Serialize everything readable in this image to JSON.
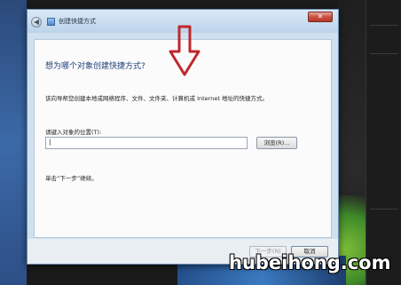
{
  "window": {
    "title": "创建快捷方式",
    "close_label": "✕",
    "back_label": "◀"
  },
  "content": {
    "heading": "想为哪个对象创建快捷方式?",
    "description": "该向导帮您创建本地或网络程序、文件、文件夹、计算机或 Internet 地址的快捷方式。",
    "location_label": "请键入对象的位置(T):",
    "location_value": "|",
    "browse_label": "浏览(R)...",
    "hint": "单击“下一步”继续。"
  },
  "footer": {
    "next_label": "下一步(N)",
    "cancel_label": "取消"
  },
  "watermark": {
    "text": "hubeihong.com"
  },
  "colors": {
    "annotation_arrow": "#c0272d",
    "heading": "#1e3f7a",
    "dialog_frame": "#cfe0ef"
  }
}
